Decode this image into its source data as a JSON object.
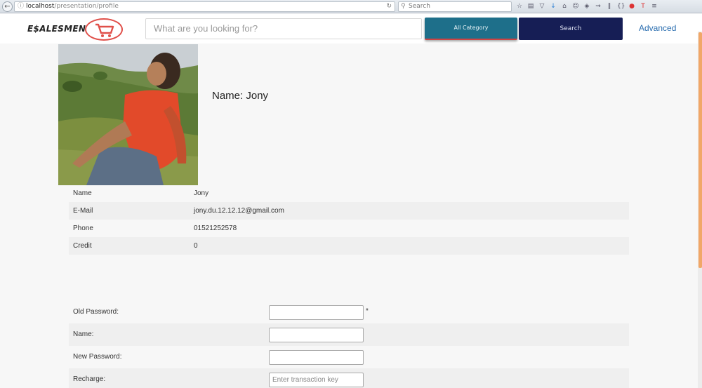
{
  "browser": {
    "url_host": "localhost",
    "url_path": "/presentation/profile",
    "search_placeholder": "Search"
  },
  "header": {
    "logo_text": "E$ALESMEN",
    "search_placeholder": "What are you looking for?",
    "category_label": "All Category",
    "search_label": "Search",
    "advanced_label": "Advanced"
  },
  "profile": {
    "name_heading": "Name: Jony",
    "rows": [
      {
        "label": "Name",
        "value": "Jony"
      },
      {
        "label": "E-Mail",
        "value": "jony.du.12.12.12@gmail.com"
      },
      {
        "label": "Phone",
        "value": "01521252578"
      },
      {
        "label": "Credit",
        "value": "0"
      }
    ]
  },
  "form": {
    "old_password_label": "Old Password:",
    "required_mark": "*",
    "name_label": "Name:",
    "new_password_label": "New Password:",
    "recharge_label": "Recharge:",
    "recharge_placeholder": "Enter transaction key"
  },
  "colors": {
    "category_button": "#1e6f8a",
    "search_button": "#161e55",
    "advanced_link": "#2c6fb0",
    "logo_accent": "#e0504a"
  }
}
